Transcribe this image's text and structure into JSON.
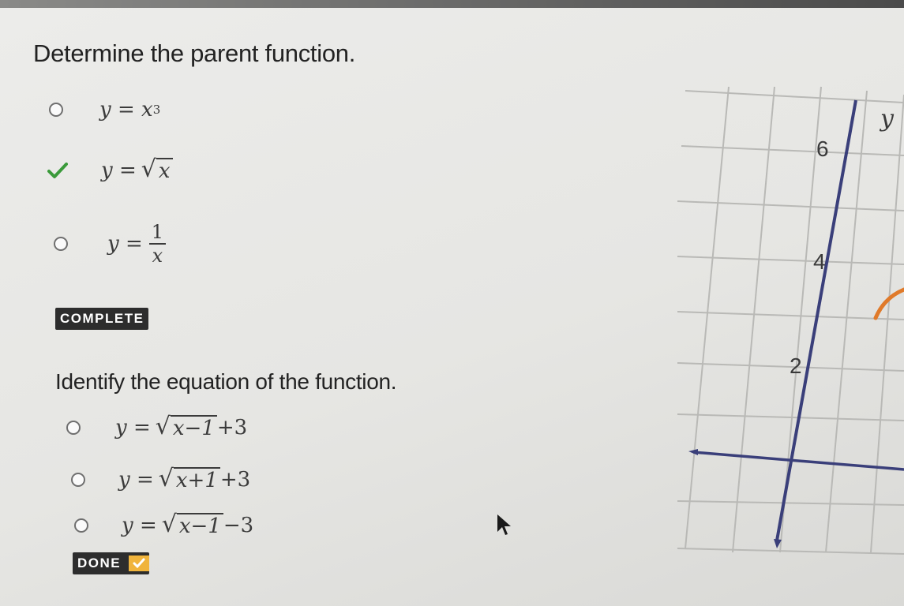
{
  "question1": {
    "prompt": "Determine the parent function.",
    "options": [
      {
        "lhs": "y",
        "eq": "=",
        "base": "x",
        "exp": "3",
        "state": "unselected"
      },
      {
        "lhs": "y",
        "eq": "=",
        "radicand": "x",
        "state": "correct"
      },
      {
        "lhs": "y",
        "eq": "=",
        "num": "1",
        "den": "x",
        "state": "unselected"
      }
    ],
    "status_badge": "COMPLETE"
  },
  "question2": {
    "prompt": "Identify the equation of the function.",
    "options": [
      {
        "lhs": "y",
        "eq": "=",
        "radicand": "x−1",
        "rest": "+3"
      },
      {
        "lhs": "y",
        "eq": "=",
        "radicand": "x+1",
        "rest": "+3"
      },
      {
        "lhs": "y",
        "eq": "=",
        "radicand": "x−1",
        "rest": "−3"
      }
    ],
    "done_label": "DONE"
  },
  "graph": {
    "y_axis_label": "y",
    "y_tick_labels": [
      "6",
      "4",
      "2"
    ],
    "colors": {
      "axis": "#3a3f7a",
      "curve": "#e07a2a",
      "grid": "#b9b9b6"
    }
  },
  "colors": {
    "check": "#3a9a3a",
    "badge_bg": "#2d2d2d",
    "done_check_bg": "#f0b43c"
  }
}
